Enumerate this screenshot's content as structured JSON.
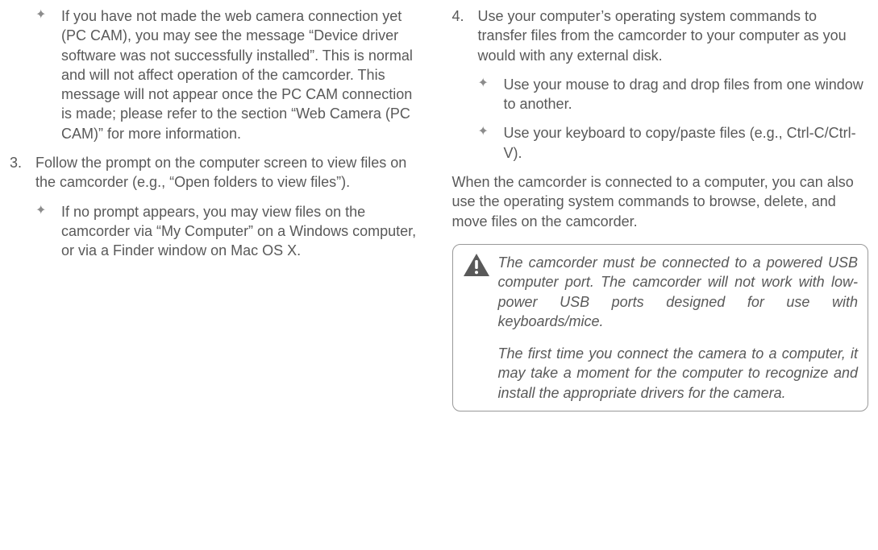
{
  "left": {
    "diamond0": "If you have not made the web camera connection yet (PC CAM), you may see the message “Device driver software was not successfully installed”. This is normal and will not affect operation of the camcorder. This message will not appear once the PC CAM connection is made; please refer to the section “Web Camera (PC CAM)” for more information.",
    "step3_num": "3.",
    "step3_text": "Follow the prompt on the computer screen to view files on the camcorder (e.g., “Open folders to view files”).",
    "step3_diamond": "If no prompt appears, you may view files on the camcorder via “My Computer” on a Windows computer, or via a Finder window on Mac OS X."
  },
  "right": {
    "step4_num": "4.",
    "step4_text": "Use your computer’s operating system com­mands to transfer files from the camcorder to your computer as you would with any external disk.",
    "step4_d1": "Use your mouse to drag and drop files from one window to another.",
    "step4_d2": "Use your keyboard to copy/paste files (e.g., Ctrl-C/Ctrl-V).",
    "para": "When the camcorder is connected to a com­puter, you can also use the operating system commands to browse, delete, and move files on the camcorder.",
    "note1": "The camcorder must be connected to a powered USB computer port. The cam­corder will not work with low-power USB ports designed for use with keyboards/mice.",
    "note2": "The first time you connect the camera to a computer, it may take a moment for the computer to recognize and install the appropriate drivers for the camera."
  },
  "glyphs": {
    "diamond": "✦"
  }
}
